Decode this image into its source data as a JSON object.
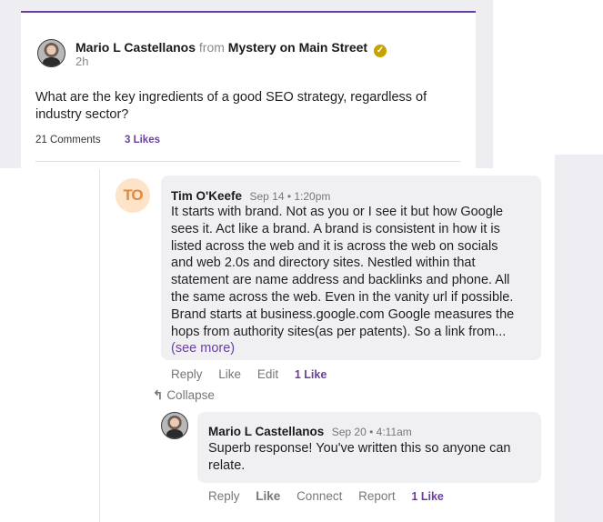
{
  "post": {
    "author": "Mario L Castellanos",
    "from_label": "from",
    "group": "Mystery on Main Street",
    "time": "2h",
    "question": "What are the key ingredients of a good SEO strategy, regardless of industry sector?",
    "comments": "21 Comments",
    "likes": "3 Likes",
    "verified_icon": "check-badge-icon"
  },
  "comment": {
    "avatar_initials": "TO",
    "author": "Tim O'Keefe",
    "date": "Sep 14 • 1:20pm",
    "lines": [
      "It starts with brand. Not as you or I see it but how Google",
      "sees it.  Act like a brand. A brand is consistent in how it is",
      "listed across the web and it is across the web on socials",
      "and web 2.0s and directory sites.  Nestled within that",
      "statement are name address and backlinks and phone. All",
      "the same across the web. Even in the vanity url if possible.",
      "Brand starts at business.google.com  Google measures the",
      "hops from authority sites(as per patents). So a link from..."
    ],
    "see_more": "(see more)",
    "actions": {
      "reply": "Reply",
      "like": "Like",
      "edit": "Edit",
      "likes": "1 Like"
    },
    "collapse": "Collapse"
  },
  "reply": {
    "author": "Mario L Castellanos",
    "date": "Sep 20 • 4:11am",
    "text": "Superb response! You've written this so anyone can relate.",
    "actions": {
      "reply": "Reply",
      "like": "Like",
      "connect": "Connect",
      "report": "Report",
      "likes": "1 Like"
    }
  },
  "colors": {
    "accent": "#6b3fa0",
    "verified": "#c8a200",
    "initials_bg": "#fde3c8",
    "initials_fg": "#e08a3c"
  }
}
